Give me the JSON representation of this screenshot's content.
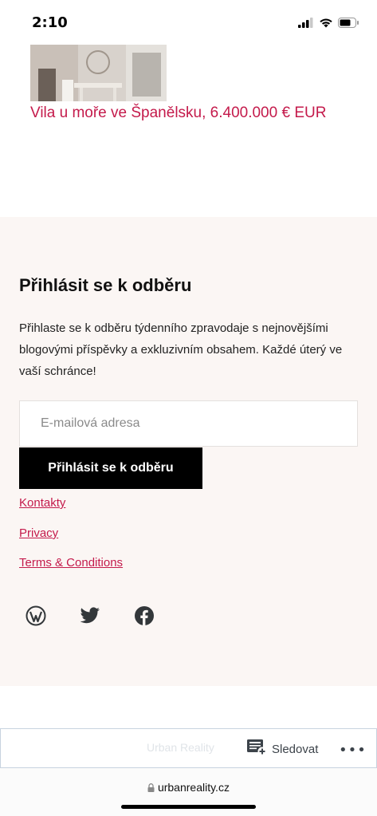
{
  "status": {
    "time": "2:10"
  },
  "post": {
    "title": "Vila u moře ve Španělsku, 6.400.000 € EUR"
  },
  "subscribe": {
    "heading": "Přihlásit se k odběru",
    "description": "Přihlaste se k odběru týdenního zpravodaje s nejnovějšími blogovými příspěvky a exkluzivním obsahem. Každé úterý ve vaší schránce!",
    "email_placeholder": "E-mailová adresa",
    "button_label": "Přihlásit se k odběru"
  },
  "links": [
    "Kontakty",
    "Privacy",
    "Terms & Conditions"
  ],
  "social": [
    "wordpress-icon",
    "twitter-icon",
    "facebook-icon"
  ],
  "follow_bar": {
    "faded_text": "Urban Reality",
    "follow_label": "Sledovat",
    "more": "•••"
  },
  "browser": {
    "url": "urbanreality.cz"
  },
  "colors": {
    "accent": "#c41a4b",
    "footer_bg": "#fbf6f4",
    "button_bg": "#000000"
  }
}
